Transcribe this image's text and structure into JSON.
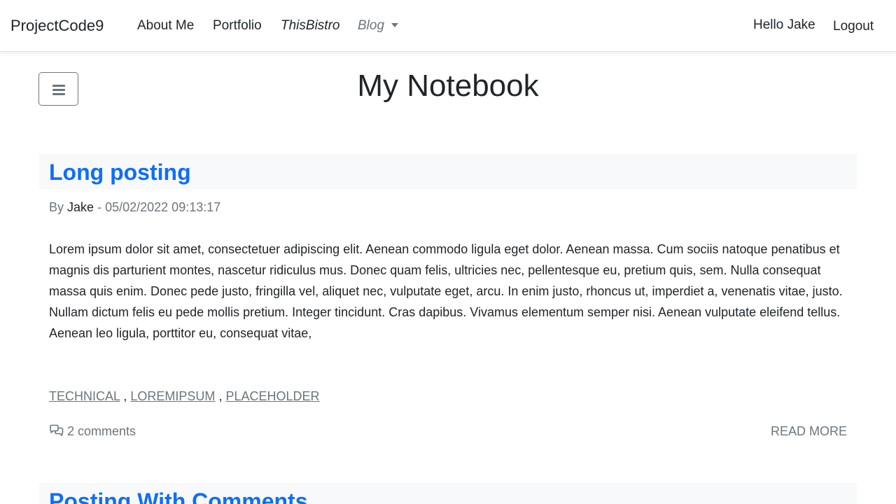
{
  "navbar": {
    "brand": "ProjectCode9",
    "links": [
      "About Me",
      "Portfolio",
      "ThisBistro"
    ],
    "blog_dropdown": "Blog",
    "greeting": "Hello Jake",
    "logout": "Logout"
  },
  "page": {
    "title": "My Notebook"
  },
  "posts": [
    {
      "title": "Long posting",
      "by_label": "By",
      "author": "Jake",
      "separator": "-",
      "date": "05/02/2022 09:13:17",
      "excerpt": "Lorem ipsum dolor sit amet, consectetuer adipiscing elit. Aenean commodo ligula eget dolor. Aenean massa. Cum sociis natoque penatibus et magnis dis parturient montes, nascetur ridiculus mus. Donec quam felis, ultricies nec, pellentesque eu, pretium quis, sem. Nulla consequat massa quis enim. Donec pede justo, fringilla vel, aliquet nec, vulputate eget, arcu. In enim justo, rhoncus ut, imperdiet a, venenatis vitae, justo. Nullam dictum felis eu pede mollis pretium. Integer tincidunt. Cras dapibus. Vivamus elementum semper nisi. Aenean vulputate eleifend tellus. Aenean leo ligula, porttitor eu, consequat vitae,",
      "tags": [
        "TECHNICAL",
        "LOREMIPSUM",
        "PLACEHOLDER"
      ],
      "tag_separator": ",",
      "comments": "2 comments",
      "read_more": "READ MORE"
    },
    {
      "title": "Posting With Comments"
    }
  ],
  "icons": {
    "menu": "hamburger-icon",
    "comments": "chat-bubbles-icon",
    "dropdown": "caret-down-icon"
  },
  "colors": {
    "link_blue": "#0d6efd",
    "muted": "#6c757d",
    "header_bg": "#f8f9fa"
  }
}
